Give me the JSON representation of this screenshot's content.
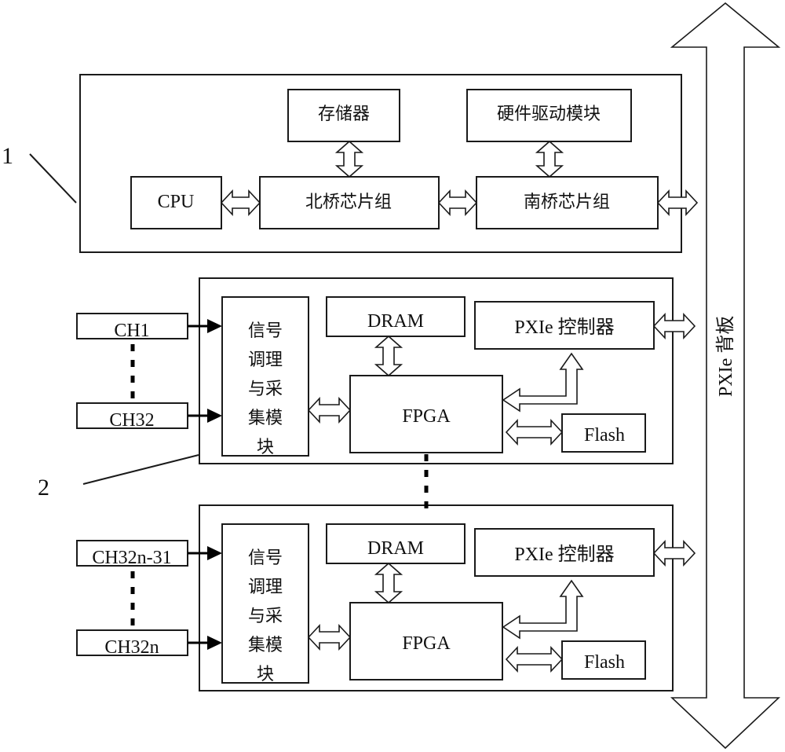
{
  "diagram": {
    "callouts": {
      "host": "1",
      "card": "2"
    },
    "backplane": {
      "label": "PXIe 背板"
    },
    "host": {
      "storage": "存储器",
      "driver": "硬件驱动模块",
      "cpu": "CPU",
      "northbridge": "北桥芯片组",
      "southbridge": "南桥芯片组"
    },
    "cards": [
      {
        "channels": [
          "CH1",
          "CH32"
        ],
        "signal_module": [
          "信号",
          "调理",
          "与采",
          "集模",
          "块"
        ],
        "dram": "DRAM",
        "fpga": "FPGA",
        "controller": "PXIe 控制器",
        "flash": "Flash"
      },
      {
        "channels": [
          "CH32n-31",
          "CH32n"
        ],
        "signal_module": [
          "信号",
          "调理",
          "与采",
          "集模",
          "块"
        ],
        "dram": "DRAM",
        "fpga": "FPGA",
        "controller": "PXIe 控制器",
        "flash": "Flash"
      }
    ]
  }
}
